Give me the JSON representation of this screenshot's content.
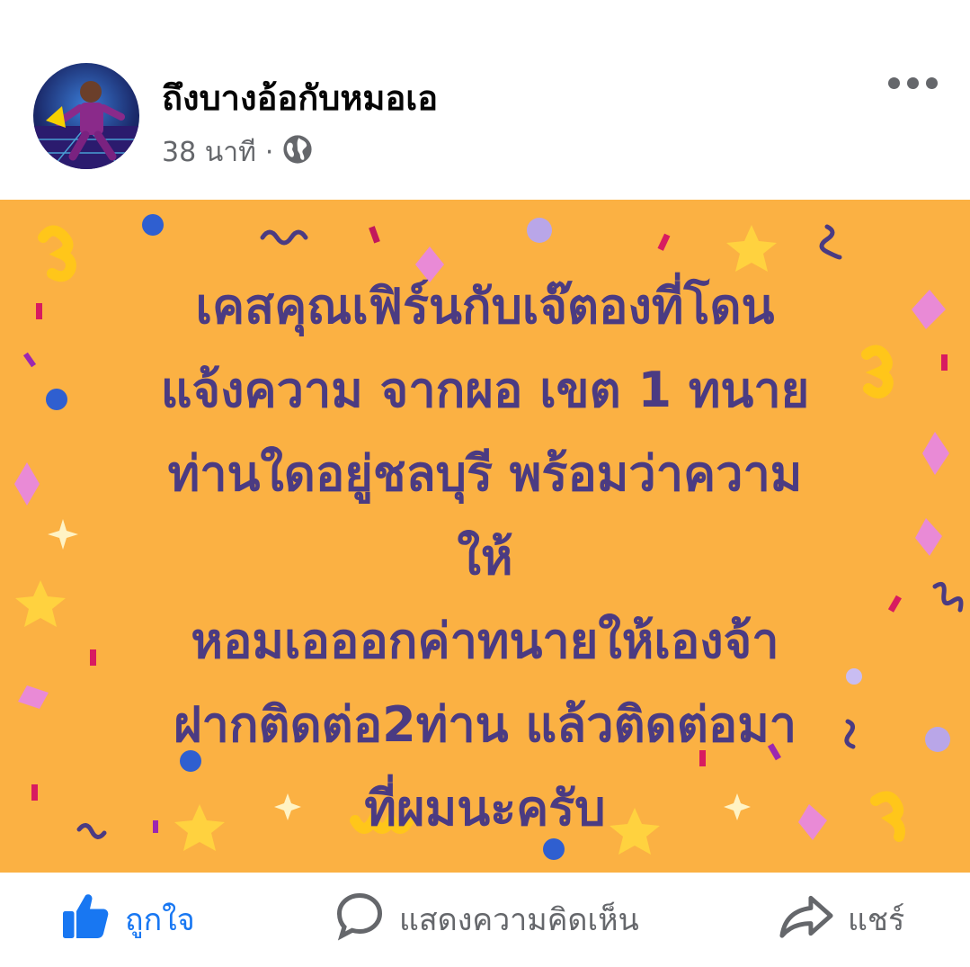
{
  "post": {
    "author": "ถึงบางอ้อกับหมอเอ",
    "time": "38 นาที",
    "separator": "·",
    "privacy_icon": "globe-icon",
    "more_icon": "more-dots-icon",
    "text_lines": [
      "เคสคุณเฟิร์นกับเจ๊ตองที่โดน",
      "แจ้งความ จากผอ เขต 1 ทนาย",
      "ท่านใดอยู่ชลบุรี พร้อมว่าความ",
      "ให้",
      "หอมเอออกค่าทนายให้เองจ้า",
      "ฝากติดต่อ2ท่าน แล้วติดต่อมา",
      "ที่ผมนะครับ"
    ],
    "background_color": "#fbb143",
    "text_color": "#4b3b82"
  },
  "actions": {
    "like": {
      "label": "ถูกใจ",
      "icon": "thumbs-up-icon",
      "color": "#1877f2"
    },
    "comment": {
      "label": "แสดงความคิดเห็น",
      "icon": "comment-bubble-icon"
    },
    "share": {
      "label": "แชร์",
      "icon": "share-arrow-icon"
    }
  }
}
